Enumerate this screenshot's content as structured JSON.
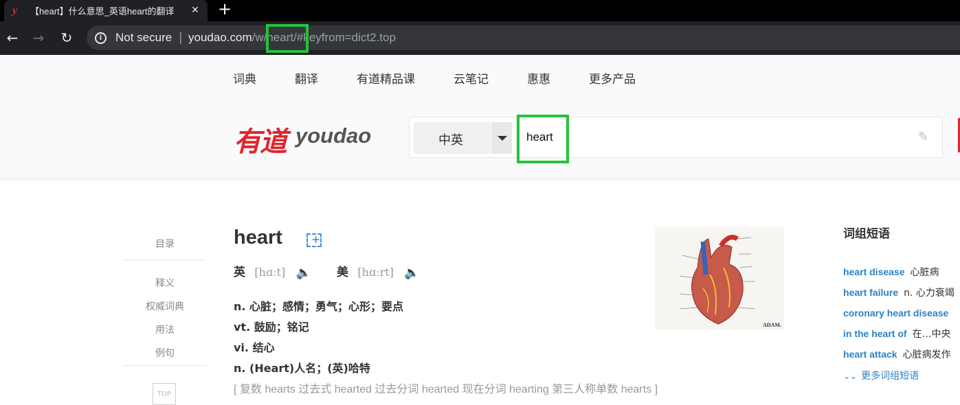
{
  "browser": {
    "tab_title": "【heart】什么意思_英语heart的翻译",
    "tab_favicon": "y",
    "new_tab": "+",
    "not_secure": "Not secure",
    "separator": "|",
    "url_host": "youdao.com",
    "url_path": "/w/heart/#keyfrom=dict2.top"
  },
  "topnav": [
    "词典",
    "翻译",
    "有道精品课",
    "云笔记",
    "惠惠",
    "更多产品"
  ],
  "logo": {
    "cn": "有道",
    "en": "youdao"
  },
  "search": {
    "lang": "中英",
    "query": "heart"
  },
  "toc": {
    "title": "目录",
    "items": [
      "释义",
      "权威词典",
      "用法",
      "例句"
    ],
    "top_label": "TOP"
  },
  "entry": {
    "word": "heart",
    "uk_label": "英",
    "uk_ipa": "[hɑːt]",
    "us_label": "美",
    "us_ipa": "[hɑːrt]",
    "translations": [
      "n. 心脏；感情；勇气；心形；要点",
      "vt. 鼓励；铭记",
      "vi. 结心",
      "n. (Heart)人名；(英)哈特"
    ],
    "forms": "[ 复数 hearts 过去式 hearted 过去分词 hearted 现在分词 hearting 第三人称单数 hearts ]"
  },
  "image": {
    "credit": "ADAM."
  },
  "phrases": {
    "title": "词组短语",
    "items": [
      {
        "en": "heart disease",
        "cn": "心脏病"
      },
      {
        "en": "heart failure",
        "cn": "n. 心力衰竭"
      },
      {
        "en": "coronary heart disease",
        "cn": ""
      },
      {
        "en": "in the heart of",
        "cn": "在…中央"
      },
      {
        "en": "heart attack",
        "cn": "心脏病发作"
      }
    ],
    "more": "更多词组短语"
  }
}
